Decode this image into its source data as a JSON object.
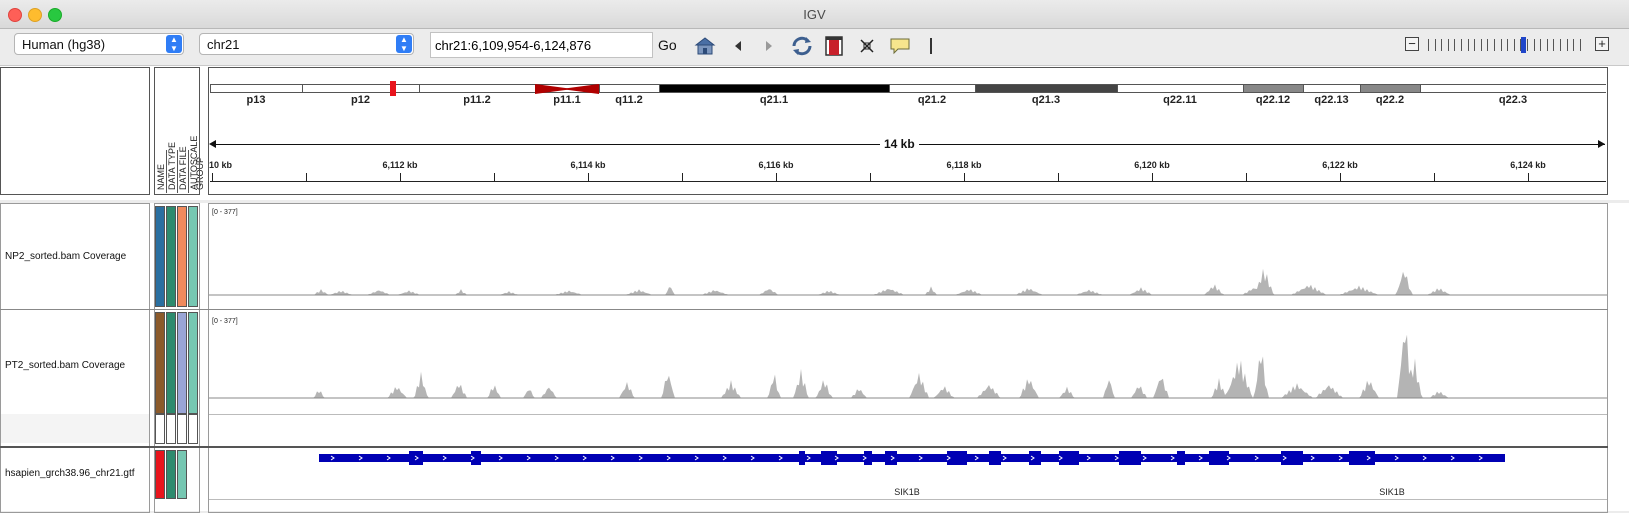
{
  "window": {
    "title": "IGV"
  },
  "toolbar": {
    "genome": "Human (hg38)",
    "chromosome": "chr21",
    "locus": "chr21:6,109,954-6,124,876",
    "go_label": "Go",
    "icons": [
      "home-icon",
      "back-icon",
      "forward-icon",
      "refresh-icon",
      "region-of-interest-icon",
      "resize-icon",
      "popup-info-icon",
      "ruler-line-icon"
    ],
    "zoom_out": "−",
    "zoom_in": "+",
    "zoom_level_fraction": 0.6
  },
  "attribute_headers": [
    "NAME",
    "DATA TYPE",
    "DATA FILE",
    "AUTOSCALE",
    "GROUP"
  ],
  "cytoband": {
    "bands": [
      {
        "label": "p13",
        "stain": "gneg"
      },
      {
        "label": "p12",
        "stain": "gneg"
      },
      {
        "label": "p11.2",
        "stain": "gneg"
      },
      {
        "label": "p11.1",
        "stain": "acen"
      },
      {
        "label": "q11.2",
        "stain": "gneg"
      },
      {
        "label": "q21.1",
        "stain": "gpos100"
      },
      {
        "label": "q21.2",
        "stain": "gneg"
      },
      {
        "label": "q21.3",
        "stain": "gpos75"
      },
      {
        "label": "q22.11",
        "stain": "gneg"
      },
      {
        "label": "q22.12",
        "stain": "gpos50"
      },
      {
        "label": "q22.13",
        "stain": "gneg"
      },
      {
        "label": "q22.2",
        "stain": "gpos50"
      },
      {
        "label": "q22.3",
        "stain": "gneg"
      }
    ],
    "current_view_color": "#e8141c"
  },
  "ruler": {
    "span_label": "14 kb",
    "first_label": "10 kb",
    "labels": [
      "6,112 kb",
      "6,114 kb",
      "6,116 kb",
      "6,118 kb",
      "6,120 kb",
      "6,122 kb",
      "6,124 kb"
    ]
  },
  "tracks": [
    {
      "name": "NP2_sorted.bam Coverage",
      "range": "[0 - 377]",
      "attr_colors": [
        "#2a6fa0",
        "#2e8b6e",
        "#f08a5d",
        "#76c7b2"
      ],
      "color": "#b4b4b4"
    },
    {
      "name": "PT2_sorted.bam Coverage",
      "range": "[0 - 377]",
      "attr_colors": [
        "#8b5a2b",
        "#2e8b6e",
        "#9aa5d6",
        "#76c7b2"
      ],
      "color": "#b4b4b4"
    },
    {
      "name": "hsapien_grch38.96_chr21.gtf",
      "attr_colors": [
        "#e8141c",
        "#2e8b6e",
        "#76c7b2"
      ],
      "gene_color": "#0000b4",
      "gene_labels": [
        "SIK1B",
        "SIK1B"
      ]
    }
  ]
}
